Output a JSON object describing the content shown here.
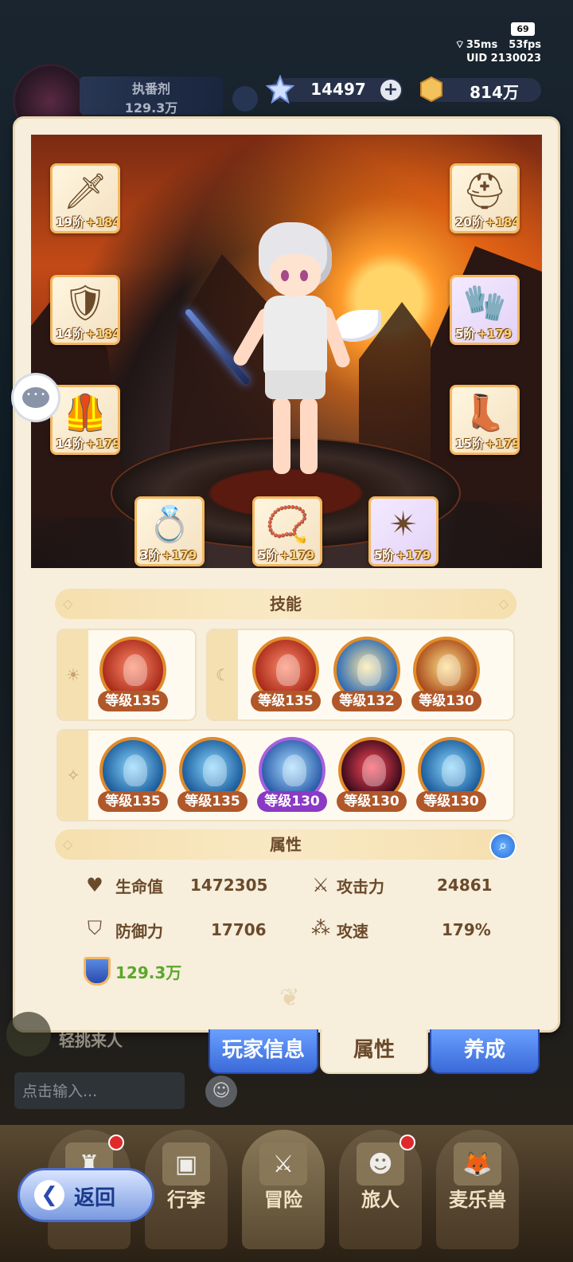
{
  "status": {
    "battery": "69",
    "ping": "35ms",
    "fps": "53fps",
    "uid": "UID  2130023"
  },
  "background_header": {
    "name": "执番剂",
    "power": "129.3万"
  },
  "currency": {
    "stars": "14497",
    "plus": "+",
    "gold": "814万"
  },
  "equipment": [
    {
      "name": "sword",
      "tier": "19阶",
      "enhance": "+184",
      "icon": "🗡"
    },
    {
      "name": "helmet",
      "tier": "20阶",
      "enhance": "+184",
      "icon": "⛑"
    },
    {
      "name": "armor",
      "tier": "14阶",
      "enhance": "+184",
      "icon": "🛡"
    },
    {
      "name": "gauntlet",
      "tier": "5阶",
      "enhance": "+179",
      "icon": "🧤"
    },
    {
      "name": "pants",
      "tier": "14阶",
      "enhance": "+179",
      "icon": "🦺"
    },
    {
      "name": "boots",
      "tier": "15阶",
      "enhance": "+179",
      "icon": "👢"
    },
    {
      "name": "ring",
      "tier": "3阶",
      "enhance": "+179",
      "icon": "💍"
    },
    {
      "name": "necklace",
      "tier": "5阶",
      "enhance": "+179",
      "icon": "📿"
    },
    {
      "name": "amulet",
      "tier": "5阶",
      "enhance": "+179",
      "icon": "✴"
    }
  ],
  "skills_header": "技能",
  "skills": {
    "sun_side": "☀",
    "moon_side": "☾",
    "star_side": "✧",
    "sun": [
      {
        "level": "等级135",
        "style": "red"
      }
    ],
    "moon": [
      {
        "level": "等级135",
        "style": "red"
      },
      {
        "level": "等级132",
        "style": "lion"
      },
      {
        "level": "等级130",
        "style": "gold"
      }
    ],
    "star": [
      {
        "level": "等级135",
        "style": "blue"
      },
      {
        "level": "等级135",
        "style": "blue"
      },
      {
        "level": "等级130",
        "style": "purple"
      },
      {
        "level": "等级130",
        "style": "dark"
      },
      {
        "level": "等级130",
        "style": "blue"
      }
    ]
  },
  "attributes_header": "属性",
  "attributes": {
    "hp_label": "生命值",
    "hp": "1472305",
    "atk_label": "攻击力",
    "atk": "24861",
    "def_label": "防御力",
    "def": "17706",
    "spd_label": "攻速",
    "spd": "179%",
    "power": "129.3万"
  },
  "tabs": {
    "player_info": "玩家信息",
    "attributes": "属性",
    "develop": "养成"
  },
  "chat": {
    "name": "轻挑来人",
    "input_placeholder": "点击输入..."
  },
  "nav": [
    "行李",
    "冒险",
    "旅人",
    "麦乐兽"
  ],
  "back": "返回",
  "colors": {
    "panel": "#f7eedc",
    "accent_blue": "#3a6ad8",
    "orange_border": "#f4b860",
    "green_power": "#5aa82a"
  }
}
